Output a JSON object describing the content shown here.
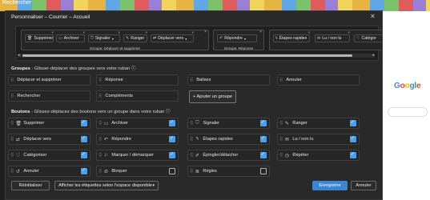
{
  "background": {
    "left_text": "Rechercher",
    "right_brand": "Google"
  },
  "dialog": {
    "title": "Personnaliser – Courrier – Accueil",
    "close_symbol": "✕"
  },
  "preview": {
    "groups": [
      {
        "label": "Groupe: Déplacer et supprimer",
        "buttons": [
          "Supprimer",
          "Archiver",
          "Signaler",
          "Ranger",
          "Déplacer vers"
        ]
      },
      {
        "label": "Groupe: Réponse",
        "buttons": [
          "Répondre"
        ]
      },
      {
        "label": "",
        "buttons": [
          "Étapes rapides",
          "Lu / non lu",
          "Catégor"
        ]
      }
    ]
  },
  "groups_section": {
    "title": "Groupes",
    "subtitle": " - Glisser-déplacer des groupes vers votre ruban ⓘ",
    "items": [
      "Déplacer et supprimer",
      "Réponse",
      "Balises",
      "Annuler",
      "Rechercher",
      "Compléments"
    ],
    "add_group_label": "+ Ajouter un groupe"
  },
  "buttons_section": {
    "title": "Boutons",
    "subtitle": " - Glissez-déplacez des boutons vers un groupe dans votre ruban ⓘ",
    "items": [
      {
        "label": "Supprimer",
        "icon": "trash-icon",
        "checked": true
      },
      {
        "label": "Archiver",
        "icon": "archive-icon",
        "checked": true
      },
      {
        "label": "Signaler",
        "icon": "shield-icon",
        "checked": true
      },
      {
        "label": "Ranger",
        "icon": "broom-icon",
        "checked": true
      },
      {
        "label": "Déplacer vers",
        "icon": "move-icon",
        "checked": true
      },
      {
        "label": "Répondre",
        "icon": "reply-icon",
        "checked": true
      },
      {
        "label": "Étapes rapides",
        "icon": "lightning-icon",
        "checked": true
      },
      {
        "label": "Lu / non lu",
        "icon": "envelope-icon",
        "checked": true
      },
      {
        "label": "Catégoriser",
        "icon": "tag-icon",
        "checked": true
      },
      {
        "label": "Marquer / démarquer",
        "icon": "flag-icon",
        "checked": true
      },
      {
        "label": "Épingler/détacher",
        "icon": "pin-icon",
        "checked": true
      },
      {
        "label": "Répéter",
        "icon": "clock-icon",
        "checked": true
      },
      {
        "label": "Annuler",
        "icon": "undo-icon",
        "checked": true
      },
      {
        "label": "Bloquer",
        "icon": "block-icon",
        "checked": false
      },
      {
        "label": "Règles",
        "icon": "rules-icon",
        "checked": false
      }
    ]
  },
  "footer": {
    "reset_label": "Réinitialiser",
    "labels_option": "Afficher les étiquettes selon l'espace disponible",
    "save_label": "Enregistrer",
    "cancel_label": "Annuler"
  },
  "colors": {
    "accent": "#3b86d3",
    "checkbox": "#4aa0ef",
    "dialog_bg": "#292929"
  }
}
